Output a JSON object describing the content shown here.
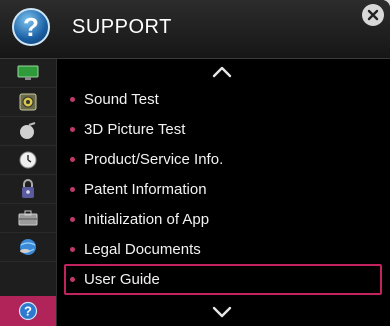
{
  "header": {
    "title": "SUPPORT",
    "icon": "question-circle-icon"
  },
  "close_icon": "close-icon",
  "sidebar": {
    "items": [
      {
        "name": "picture-settings-icon",
        "active": false
      },
      {
        "name": "audio-settings-icon",
        "active": false
      },
      {
        "name": "channel-settings-icon",
        "active": false
      },
      {
        "name": "time-settings-icon",
        "active": false
      },
      {
        "name": "lock-settings-icon",
        "active": false
      },
      {
        "name": "option-settings-icon",
        "active": false
      },
      {
        "name": "network-settings-icon",
        "active": false
      },
      {
        "name": "support-icon",
        "active": true
      }
    ]
  },
  "menu": {
    "items": [
      {
        "label": "Sound Test"
      },
      {
        "label": "3D Picture Test"
      },
      {
        "label": "Product/Service Info."
      },
      {
        "label": "Patent Information"
      },
      {
        "label": "Initialization of App"
      },
      {
        "label": "Legal Documents"
      },
      {
        "label": "User Guide"
      }
    ],
    "selected_index": 6
  },
  "colors": {
    "accent": "#c2235f",
    "background": "#000000",
    "sidebar": "#1e1e1e"
  }
}
